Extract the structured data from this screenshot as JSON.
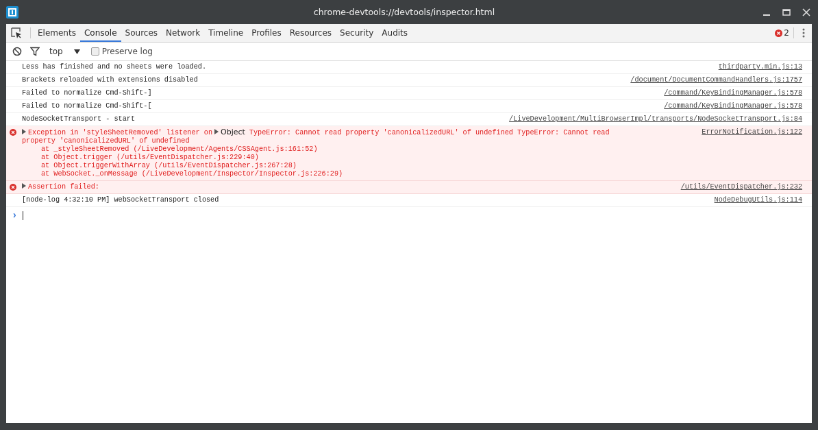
{
  "window": {
    "title": "chrome-devtools://devtools/inspector.html"
  },
  "tabs": [
    {
      "label": "Elements",
      "selected": false
    },
    {
      "label": "Console",
      "selected": true
    },
    {
      "label": "Sources",
      "selected": false
    },
    {
      "label": "Network",
      "selected": false
    },
    {
      "label": "Timeline",
      "selected": false
    },
    {
      "label": "Profiles",
      "selected": false
    },
    {
      "label": "Resources",
      "selected": false
    },
    {
      "label": "Security",
      "selected": false
    },
    {
      "label": "Audits",
      "selected": false
    }
  ],
  "error_count": "2",
  "toolbar": {
    "context": "top",
    "preserve_log": {
      "label": "Preserve log",
      "checked": false
    }
  },
  "messages": [
    {
      "kind": "log",
      "text": "Less has finished and no sheets were loaded.",
      "source": "thirdparty.min.js:13"
    },
    {
      "kind": "log",
      "text": "Brackets reloaded with extensions disabled",
      "source": "/document/DocumentCommandHandlers.js:1757"
    },
    {
      "kind": "log",
      "text": "Failed to normalize Cmd-Shift-]",
      "source": "/command/KeyBindingManager.js:578"
    },
    {
      "kind": "log",
      "text": "Failed to normalize Cmd-Shift-[",
      "source": "/command/KeyBindingManager.js:578"
    },
    {
      "kind": "log",
      "text": "NodeSocketTransport - start",
      "source": "/LiveDevelopment/MultiBrowserImpl/transports/NodeSocketTransport.js:84"
    },
    {
      "kind": "error",
      "text": "Exception in 'styleSheetRemoved' listener on",
      "object": "Object",
      "rest": "TypeError: Cannot read property 'canonicalizedURL' of undefined TypeError: Cannot read",
      "continuation": "property 'canonicalizedURL' of undefined",
      "stack": [
        "at _styleSheetRemoved (/LiveDevelopment/Agents/CSSAgent.js:161:52)",
        "at Object.trigger (/utils/EventDispatcher.js:229:40)",
        "at Object.triggerWithArray (/utils/EventDispatcher.js:267:28)",
        "at WebSocket._onMessage (/LiveDevelopment/Inspector/Inspector.js:226:29)"
      ],
      "source": "ErrorNotification.js:122"
    },
    {
      "kind": "error",
      "text": "Assertion failed:",
      "source": "/utils/EventDispatcher.js:232"
    },
    {
      "kind": "log",
      "text": "[node-log 4:32:10 PM] webSocketTransport closed",
      "source": "NodeDebugUtils.js:114"
    }
  ],
  "prompt": "›"
}
